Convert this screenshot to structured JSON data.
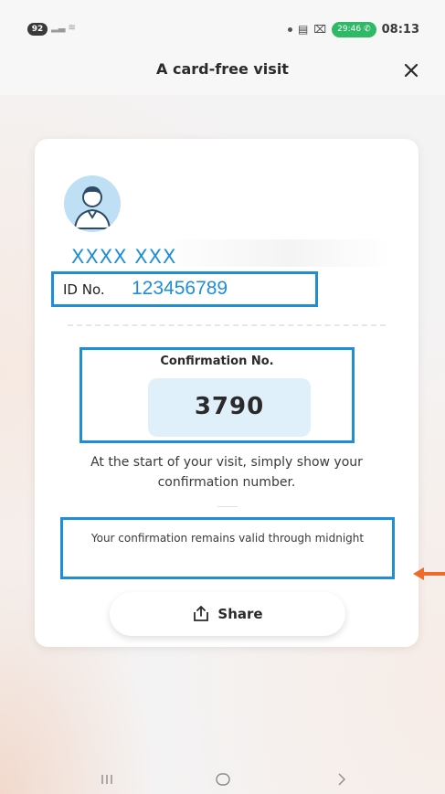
{
  "status_bar": {
    "battery_level": "92",
    "call_duration": "29:46",
    "time": "08:13"
  },
  "header": {
    "title": "A card-free visit",
    "close_icon": "close-icon"
  },
  "card": {
    "user_name": "XXXX XXX",
    "id_label": "ID No.",
    "id_value": "123456789",
    "confirmation_label": "Confirmation No.",
    "confirmation_number": "3790",
    "instruction": "At the start of your visit, simply show your confirmation number.",
    "validity_note": "Your confirmation remains valid through midnight",
    "share_label": "Share",
    "share_icon": "share-icon",
    "avatar_icon": "user-avatar-icon"
  },
  "nav_bar": {
    "items": [
      "recent-apps-icon",
      "home-icon",
      "back-icon"
    ]
  },
  "colors": {
    "accent_blue": "#1e8fd6",
    "highlight_box": "#dff0fb",
    "annotation_arrow": "#f06a2b",
    "call_green": "#2fb866"
  }
}
